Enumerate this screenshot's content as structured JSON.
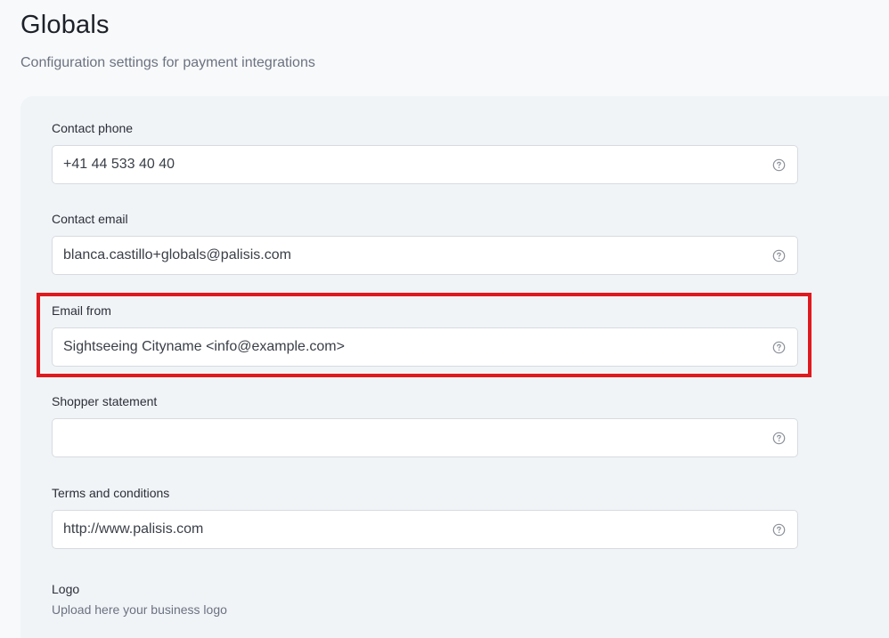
{
  "header": {
    "title": "Globals",
    "subtitle": "Configuration settings for payment integrations"
  },
  "fields": [
    {
      "label": "Contact phone",
      "value": "+41 44 533 40 40",
      "icon": "help-circle-icon"
    },
    {
      "label": "Contact email",
      "value": "blanca.castillo+globals@palisis.com",
      "icon": "help-circle-icon"
    },
    {
      "label": "Email from",
      "value": "Sightseeing Cityname <info@example.com>",
      "icon": "help-circle-icon"
    },
    {
      "label": "Shopper statement",
      "value": "",
      "icon": "help-circle-icon"
    },
    {
      "label": "Terms and conditions",
      "value": "http://www.palisis.com",
      "icon": "help-circle-icon"
    }
  ],
  "logo": {
    "label": "Logo",
    "description": "Upload here your business logo"
  },
  "colors": {
    "highlight": "#e0191e",
    "card_background": "#f1f4f7",
    "page_background": "#f8f9fb"
  }
}
